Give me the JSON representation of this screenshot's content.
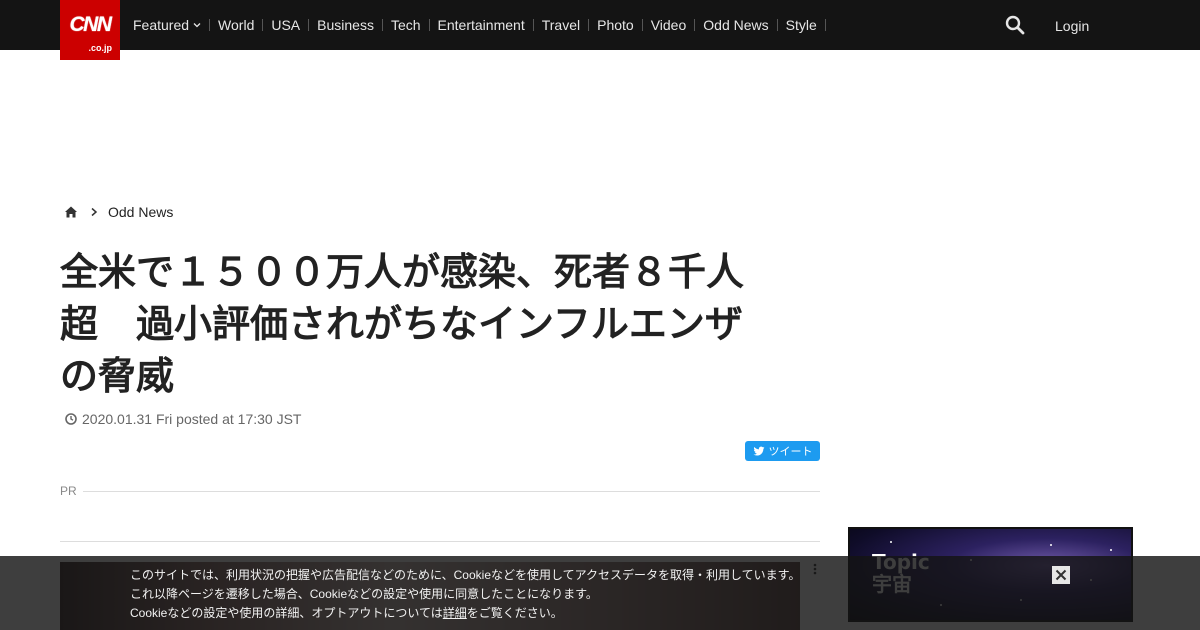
{
  "header": {
    "logo_main": "CNN",
    "logo_sub": ".co.jp",
    "nav_items": [
      "Featured",
      "World",
      "USA",
      "Business",
      "Tech",
      "Entertainment",
      "Travel",
      "Photo",
      "Video",
      "Odd News",
      "Style"
    ],
    "login_label": "Login"
  },
  "breadcrumb": {
    "category": "Odd News"
  },
  "article": {
    "title_lines": [
      "全米で１５００万人が感染、死者８千人",
      "超　過小評価されがちなインフルエンザ",
      "の脅威"
    ],
    "posted": "2020.01.31 Fri posted at 17:30 JST",
    "tweet_label": "ツイート",
    "pr_label": "PR"
  },
  "topic_banner": {
    "line1": "Topic",
    "line2": "宇宙"
  },
  "cookie": {
    "line1": "このサイトでは、利用状況の把握や広告配信などのために、Cookieなどを使用してアクセスデータを取得・利用しています。",
    "line2": "これ以降ページを遷移した場合、Cookieなどの設定や使用に同意したことになります。",
    "line3_pre": "Cookieなどの設定や使用の詳細、オプトアウトについては",
    "line3_link": "詳細",
    "line3_post": "をご覧ください。"
  },
  "colors": {
    "brand_red": "#cc0000",
    "nav_bg": "#141414",
    "twitter_blue": "#1d9bf0"
  }
}
